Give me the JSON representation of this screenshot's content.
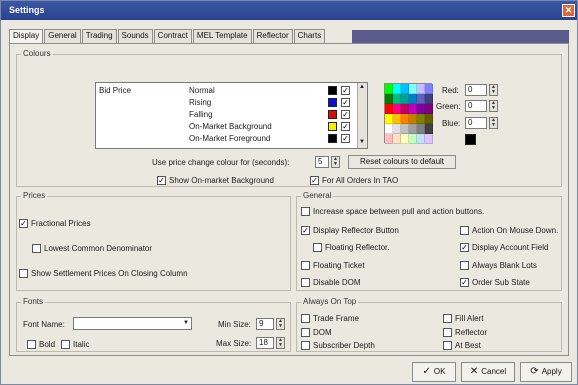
{
  "window": {
    "title": "Settings",
    "close_glyph": "✕"
  },
  "tabs": [
    "Display",
    "General",
    "Trading",
    "Sounds",
    "Contract",
    "MEL Template",
    "Reflector",
    "Charts"
  ],
  "colours": {
    "legend": "Colours",
    "category": "Bid Price",
    "rows": [
      {
        "label": "Normal",
        "color": "#000000",
        "checked": true
      },
      {
        "label": "Rising",
        "color": "#1010c8",
        "checked": true
      },
      {
        "label": "Falling",
        "color": "#d01010",
        "checked": true
      },
      {
        "label": "On-Market Background",
        "color": "#f0f000",
        "checked": true
      },
      {
        "label": "On-Market Foreground",
        "color": "#000000",
        "checked": true
      }
    ],
    "palette": [
      "#00ff00",
      "#00ffff",
      "#00c0ff",
      "#80ffff",
      "#c0c0ff",
      "#8080ff",
      "#008000",
      "#00c080",
      "#00a0a0",
      "#0080c0",
      "#6060c0",
      "#404080",
      "#ff0000",
      "#ff0080",
      "#c00060",
      "#c000c0",
      "#8000a0",
      "#800080",
      "#ffff00",
      "#ffc000",
      "#ff8000",
      "#c08000",
      "#808000",
      "#606000",
      "#ffffff",
      "#e0e0e0",
      "#c0c0c0",
      "#a0a0a0",
      "#808080",
      "#404040",
      "#ffc0c0",
      "#ffe0c0",
      "#ffffc0",
      "#c0ffc0",
      "#c0e0ff",
      "#e0c0ff"
    ],
    "red_label": "Red:",
    "red_value": "0",
    "green_label": "Green:",
    "green_value": "0",
    "blue_label": "Blue:",
    "blue_value": "0",
    "current_color": "#000000",
    "price_change_label": "Use price change colour for (seconds):",
    "price_change_value": "5",
    "reset_label": "Reset colours to default",
    "show_onmarket_label": "Show On-market Background",
    "show_onmarket_checked": true,
    "for_all_orders_label": "For All Orders In TAO",
    "for_all_orders_checked": true
  },
  "prices": {
    "legend": "Prices",
    "fractional_label": "Fractional Prices",
    "fractional_checked": true,
    "lcd_label": "Lowest Common Denominator",
    "lcd_checked": false,
    "settlement_label": "Show Settlement Prices On Closing Column",
    "settlement_checked": false
  },
  "general": {
    "legend": "General",
    "increase_space_label": "Increase space between pull and action buttons.",
    "increase_space_checked": false,
    "display_reflector_label": "Display Reflector Button",
    "display_reflector_checked": true,
    "action_mouse_label": "Action On Mouse Down.",
    "action_mouse_checked": false,
    "floating_reflector_label": "Floating Reflector.",
    "floating_reflector_checked": false,
    "display_account_label": "Display Account Field",
    "display_account_checked": true,
    "floating_ticket_label": "Floating Ticket",
    "floating_ticket_checked": false,
    "always_blank_label": "Always Blank Lots",
    "always_blank_checked": false,
    "disable_dom_label": "Disable DOM",
    "disable_dom_checked": false,
    "order_sub_label": "Order Sub State",
    "order_sub_checked": true
  },
  "fonts": {
    "legend": "Fonts",
    "font_name_label": "Font Name:",
    "font_name_value": "",
    "min_size_label": "Min Size:",
    "min_size_value": "9",
    "max_size_label": "Max Size:",
    "max_size_value": "18",
    "bold_label": "Bold",
    "bold_checked": false,
    "italic_label": "Italic",
    "italic_checked": false
  },
  "always_on_top": {
    "legend": "Always On Top",
    "trade_frame_label": "Trade Frame",
    "trade_frame_checked": false,
    "fill_alert_label": "Fill Alert",
    "fill_alert_checked": false,
    "dom_label": "DOM",
    "dom_checked": false,
    "reflector_label": "Reflector",
    "reflector_checked": false,
    "subscriber_label": "Subscriber Depth",
    "subscriber_checked": false,
    "at_best_label": "At Best",
    "at_best_checked": false
  },
  "buttons": {
    "ok": "OK",
    "cancel": "Cancel",
    "apply": "Apply"
  },
  "glyphs": {
    "check": "✓",
    "cross": "✕",
    "refresh": "⟳",
    "arrow_up": "▲",
    "arrow_down": "▼"
  }
}
